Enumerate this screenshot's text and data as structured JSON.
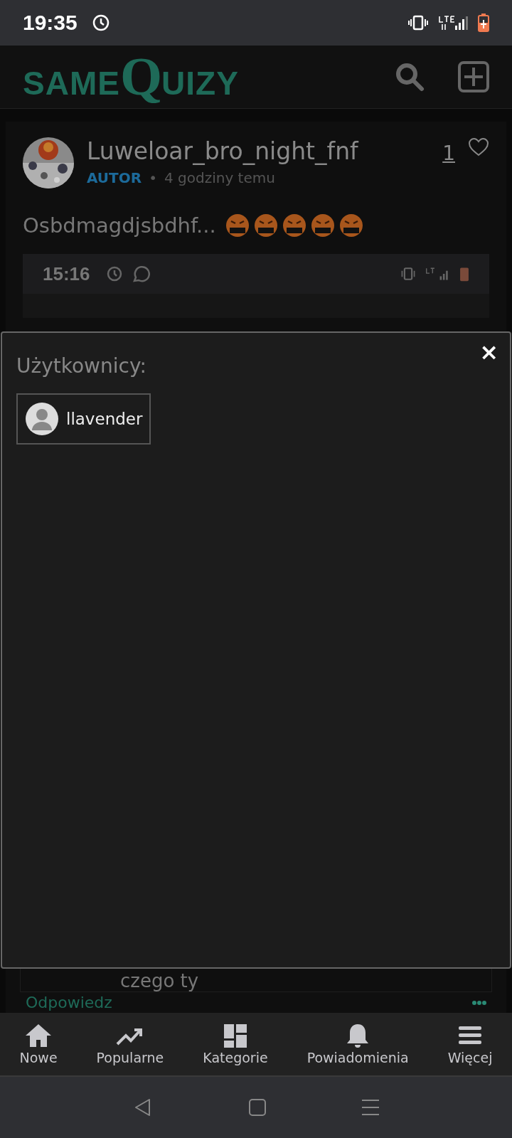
{
  "status_bar": {
    "time": "19:35"
  },
  "header": {
    "logo_start": "SAME",
    "logo_initial": "Q",
    "logo_rest": "UIZY"
  },
  "post": {
    "author": "Luweloar_bro_night_fnf",
    "role": "AUTOR",
    "separator": "•",
    "time": "4 godziny temu",
    "likes": "1",
    "text": "Osbdmagdjsbdhf...",
    "embedded_screenshot": {
      "time": "15:16"
    }
  },
  "comment": {
    "text": "czego ty",
    "reply": "Odpowiedz"
  },
  "modal": {
    "close": "×",
    "title": "Użytkownicy:",
    "users": [
      {
        "name": "llavender"
      }
    ]
  },
  "bottom_nav": [
    {
      "kind": "home",
      "label": "Nowe"
    },
    {
      "kind": "trending",
      "label": "Popularne"
    },
    {
      "kind": "grid",
      "label": "Kategorie"
    },
    {
      "kind": "bell",
      "label": "Powiadomienia"
    },
    {
      "kind": "menu",
      "label": "Więcej"
    }
  ]
}
